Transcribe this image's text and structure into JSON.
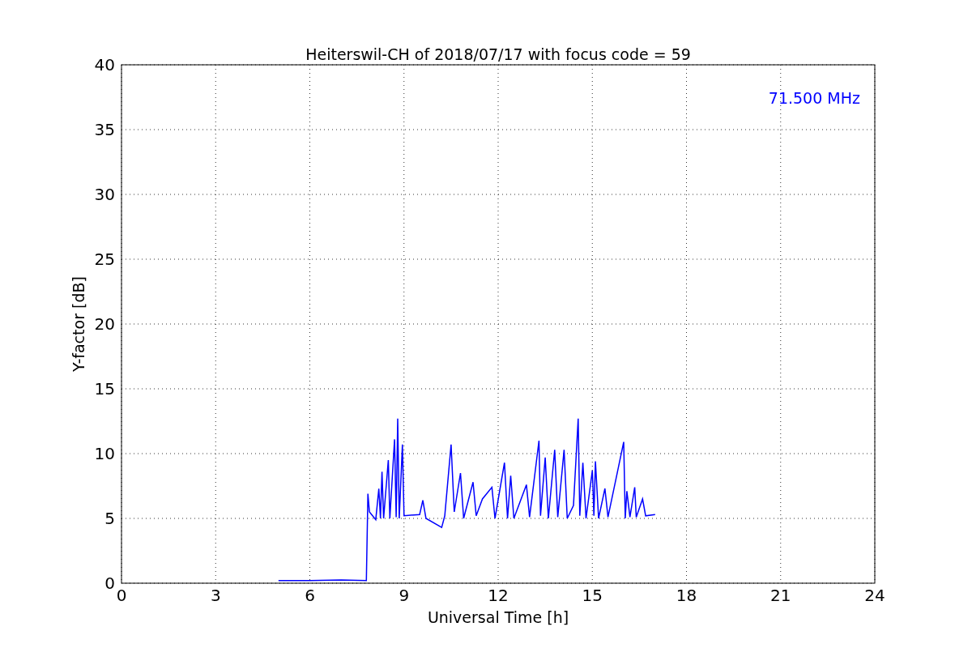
{
  "chart_data": {
    "type": "line",
    "title": "Heiterswil-CH of 2018/07/17 with focus code = 59",
    "xlabel": "Universal Time [h]",
    "ylabel": "Y-factor [dB]",
    "x": [
      5.0,
      6.0,
      7.0,
      7.8,
      7.85,
      7.9,
      8.0,
      8.1,
      8.2,
      8.25,
      8.3,
      8.35,
      8.5,
      8.55,
      8.7,
      8.75,
      8.8,
      8.85,
      8.95,
      9.0,
      9.5,
      9.6,
      9.7,
      10.2,
      10.3,
      10.5,
      10.6,
      10.8,
      10.9,
      11.2,
      11.3,
      11.5,
      11.8,
      11.9,
      12.2,
      12.3,
      12.4,
      12.5,
      12.9,
      13.0,
      13.3,
      13.35,
      13.5,
      13.6,
      13.8,
      13.9,
      14.1,
      14.2,
      14.4,
      14.55,
      14.6,
      14.7,
      14.8,
      15.0,
      15.05,
      15.1,
      15.2,
      15.4,
      15.5,
      16.0,
      16.05,
      16.1,
      16.2,
      16.35,
      16.4,
      16.6,
      16.7,
      17.0
    ],
    "series": [
      {
        "name": "71.500 MHz",
        "color": "#0000ff",
        "values": [
          0.2,
          0.2,
          0.25,
          0.2,
          6.9,
          5.5,
          5.2,
          4.9,
          7.3,
          5.0,
          8.6,
          5.0,
          9.5,
          5.0,
          11.1,
          5.1,
          12.7,
          5.0,
          10.7,
          5.2,
          5.3,
          6.4,
          5.0,
          4.3,
          5.2,
          10.7,
          5.5,
          8.5,
          5.0,
          7.8,
          5.2,
          6.5,
          7.4,
          5.0,
          9.3,
          5.0,
          8.3,
          5.0,
          7.6,
          5.1,
          11.0,
          5.2,
          9.7,
          5.0,
          10.3,
          5.1,
          10.3,
          5.0,
          6.0,
          12.7,
          5.2,
          9.3,
          5.0,
          8.7,
          5.2,
          9.4,
          5.0,
          7.3,
          5.1,
          10.9,
          5.0,
          7.1,
          5.1,
          7.4,
          5.1,
          6.5,
          5.2,
          5.3
        ]
      }
    ],
    "xlim": [
      0,
      24
    ],
    "ylim": [
      0,
      40
    ],
    "xticks": [
      0,
      3,
      6,
      9,
      12,
      15,
      18,
      21,
      24
    ],
    "yticks": [
      0,
      5,
      10,
      15,
      20,
      25,
      30,
      35,
      40
    ],
    "grid": true
  }
}
